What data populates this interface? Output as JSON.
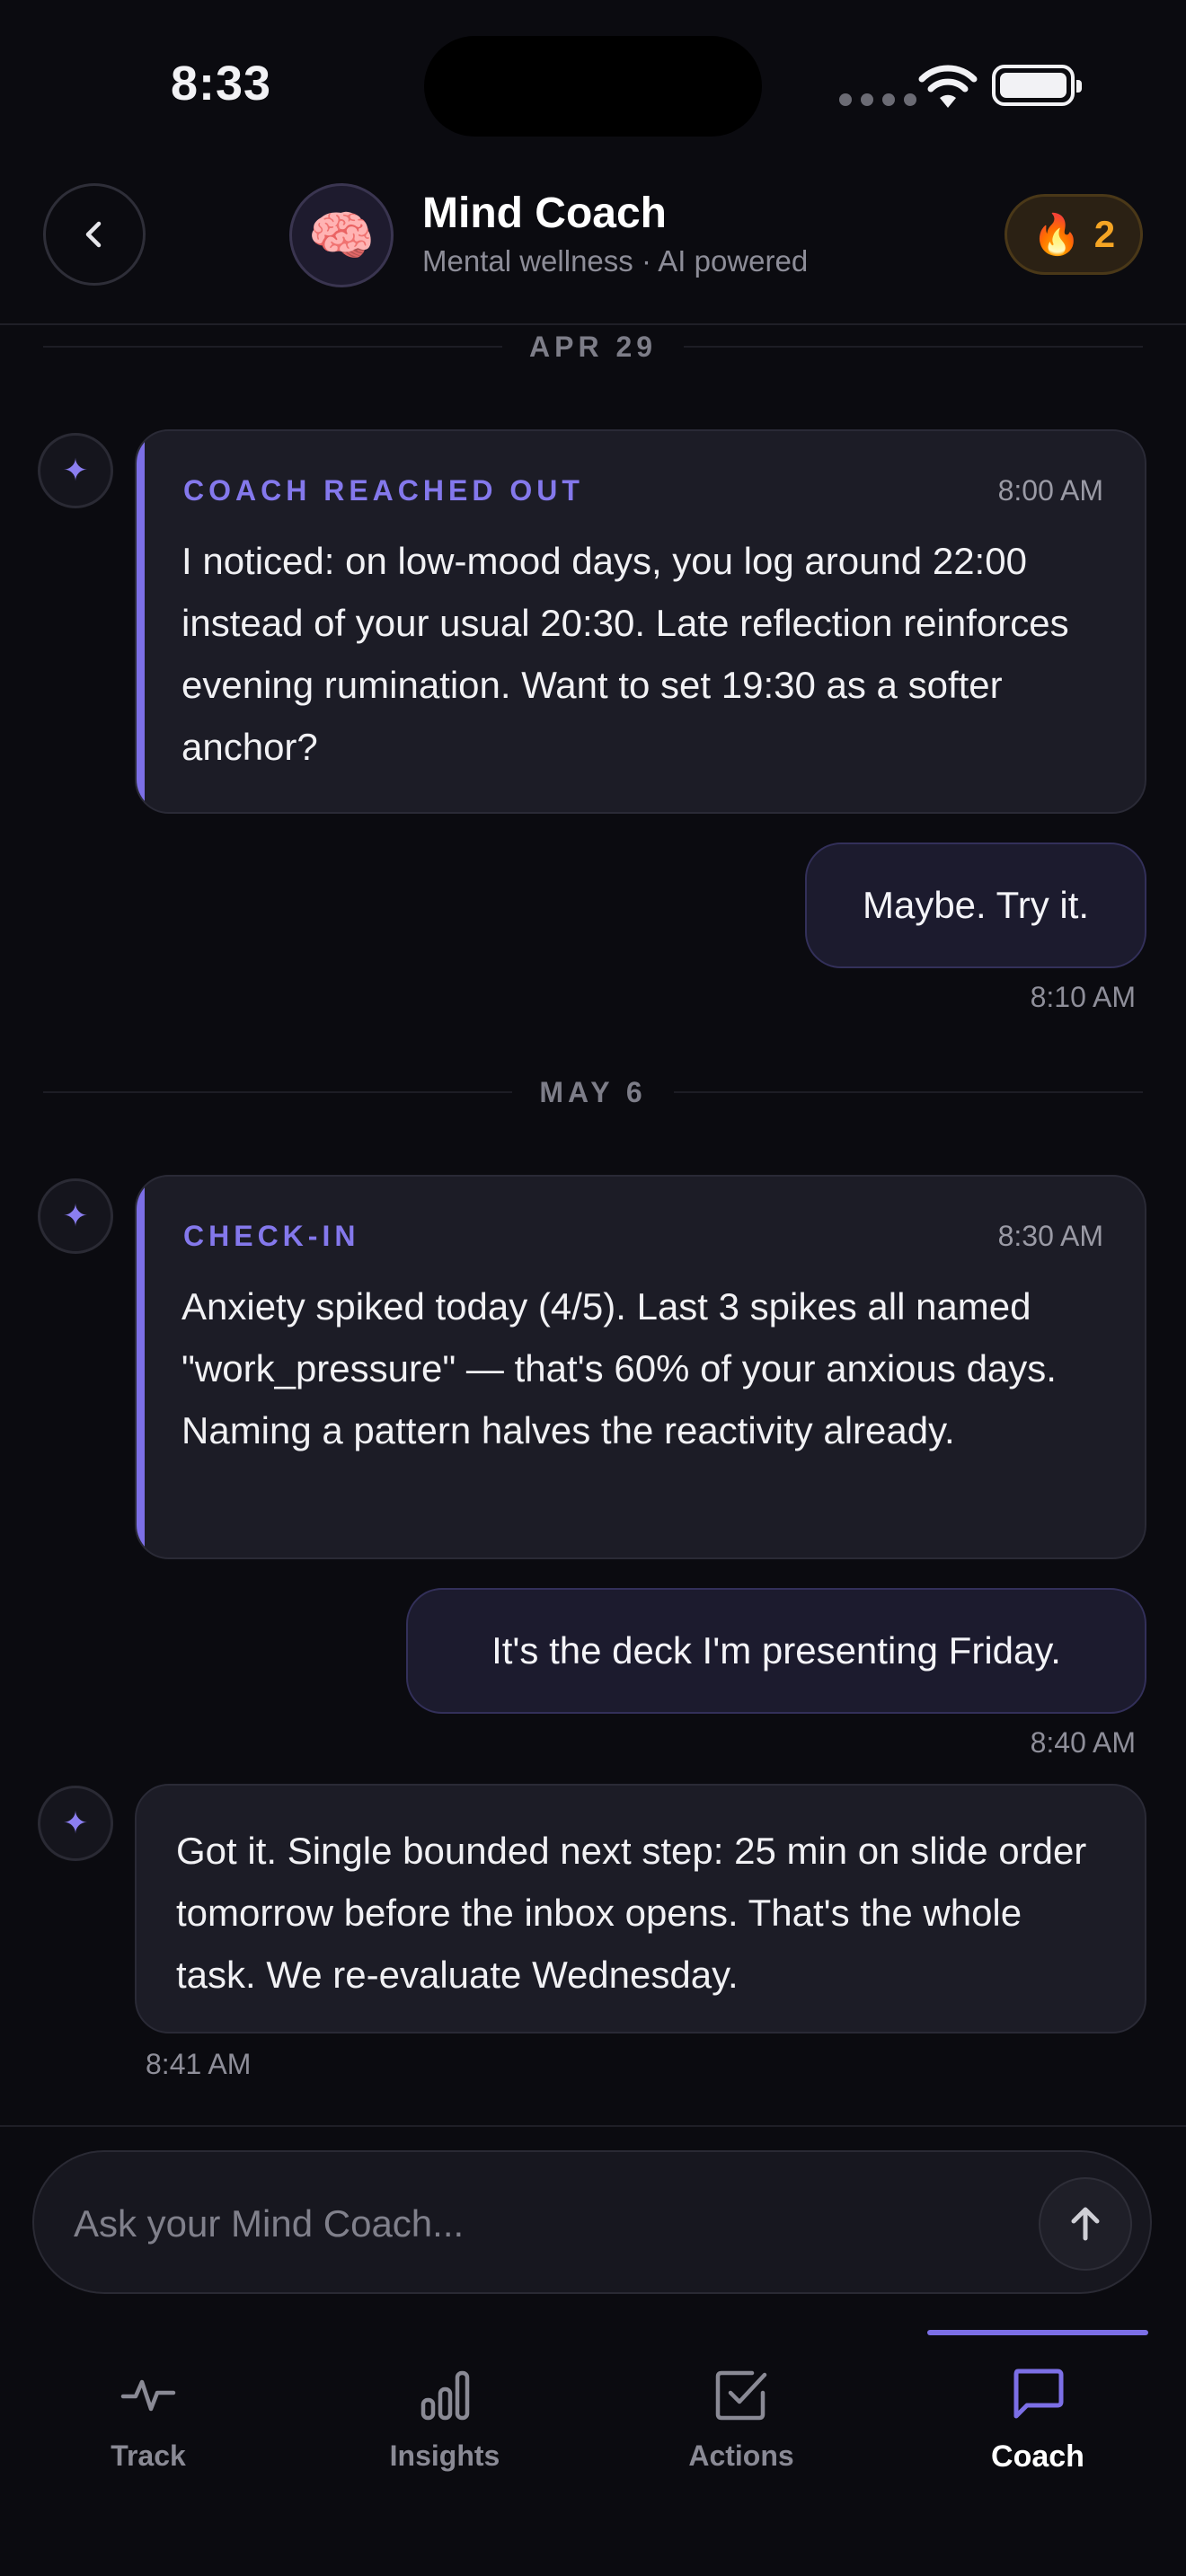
{
  "status_bar": {
    "time": "8:33"
  },
  "header": {
    "title": "Mind Coach",
    "subtitle": "Mental wellness · AI powered",
    "avatar_emoji": "🧠",
    "streak_emoji": "🔥",
    "streak_count": "2"
  },
  "conversation": {
    "sections": [
      {
        "date": "APR 29",
        "coach_message": {
          "kicker": "COACH REACHED OUT",
          "time": "8:00 AM",
          "text": "I noticed: on low-mood days, you log around 22:00 instead of your usual 20:30. Late reflection reinforces evening rumination. Want to set 19:30 as a softer anchor?"
        },
        "user_message": {
          "text": "Maybe. Try it.",
          "time": "8:10 AM"
        }
      },
      {
        "date": "MAY 6",
        "coach_message": {
          "kicker": "CHECK-IN",
          "time": "8:30 AM",
          "text": "Anxiety spiked today (4/5). Last 3 spikes all named \"work_pressure\" — that's 60% of your anxious days. Naming a pattern halves the reactivity already."
        },
        "user_message": {
          "text": "It's the deck I'm presenting Friday.",
          "time": "8:40 AM"
        },
        "coach_reply": {
          "text": "Got it. Single bounded next step: 25 min on slide order tomorrow before the inbox opens. That's the whole task. We re-evaluate Wednesday.",
          "time": "8:41 AM"
        }
      }
    ]
  },
  "composer": {
    "placeholder": "Ask your Mind Coach...",
    "value": ""
  },
  "tabs": [
    {
      "label": "Track",
      "icon": "activity-icon",
      "active": false
    },
    {
      "label": "Insights",
      "icon": "bar-chart-icon",
      "active": false
    },
    {
      "label": "Actions",
      "icon": "checkbox-icon",
      "active": false
    },
    {
      "label": "Coach",
      "icon": "chat-bubble-icon",
      "active": true
    }
  ],
  "colors": {
    "background": "#0b0b10",
    "accent": "#7c6fe6",
    "streak": "#f5a524",
    "card": "#1c1c26"
  }
}
